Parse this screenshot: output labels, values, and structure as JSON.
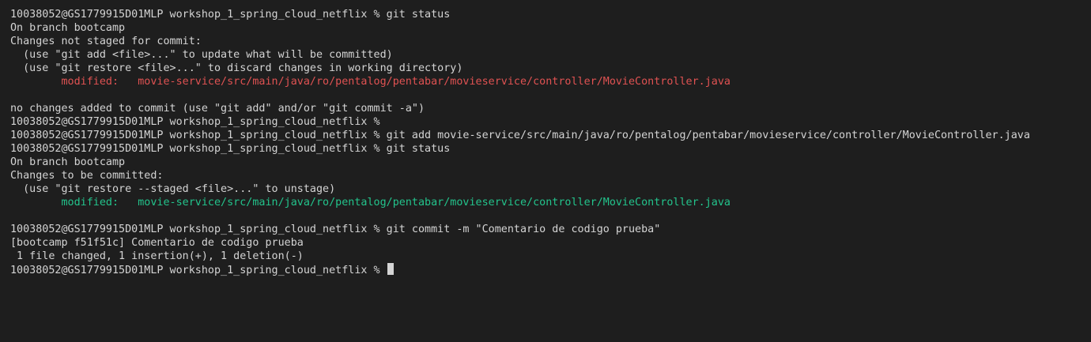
{
  "colors": {
    "background": "#1e1e1e",
    "text": "#d4d4d4",
    "unstaged": "#e05252",
    "staged": "#23c48c"
  },
  "terminal": {
    "lines": [
      {
        "kind": "prompt",
        "segments": [
          {
            "text": "10038052@GS1779915D01MLP workshop_1_spring_cloud_netflix % git status"
          }
        ]
      },
      {
        "kind": "output",
        "segments": [
          {
            "text": "On branch bootcamp"
          }
        ]
      },
      {
        "kind": "output",
        "segments": [
          {
            "text": "Changes not staged for commit:"
          }
        ]
      },
      {
        "kind": "output",
        "segments": [
          {
            "text": "  (use \"git add <file>...\" to update what will be committed)"
          }
        ]
      },
      {
        "kind": "output",
        "segments": [
          {
            "text": "  (use \"git restore <file>...\" to discard changes in working directory)"
          }
        ]
      },
      {
        "kind": "output",
        "segments": [
          {
            "text": "        modified:   movie-service/src/main/java/ro/pentalog/pentabar/movieservice/controller/MovieController.java",
            "color": "red"
          }
        ]
      },
      {
        "kind": "blank",
        "segments": [
          {
            "text": ""
          }
        ]
      },
      {
        "kind": "output",
        "segments": [
          {
            "text": "no changes added to commit (use \"git add\" and/or \"git commit -a\")"
          }
        ]
      },
      {
        "kind": "prompt",
        "segments": [
          {
            "text": "10038052@GS1779915D01MLP workshop_1_spring_cloud_netflix %"
          }
        ]
      },
      {
        "kind": "prompt",
        "segments": [
          {
            "text": "10038052@GS1779915D01MLP workshop_1_spring_cloud_netflix % git add movie-service/src/main/java/ro/pentalog/pentabar/movieservice/controller/MovieController.java"
          }
        ]
      },
      {
        "kind": "prompt",
        "segments": [
          {
            "text": "10038052@GS1779915D01MLP workshop_1_spring_cloud_netflix % git status"
          }
        ]
      },
      {
        "kind": "output",
        "segments": [
          {
            "text": "On branch bootcamp"
          }
        ]
      },
      {
        "kind": "output",
        "segments": [
          {
            "text": "Changes to be committed:"
          }
        ]
      },
      {
        "kind": "output",
        "segments": [
          {
            "text": "  (use \"git restore --staged <file>...\" to unstage)"
          }
        ]
      },
      {
        "kind": "output",
        "segments": [
          {
            "text": "        modified:   movie-service/src/main/java/ro/pentalog/pentabar/movieservice/controller/MovieController.java",
            "color": "green"
          }
        ]
      },
      {
        "kind": "blank",
        "segments": [
          {
            "text": ""
          }
        ]
      },
      {
        "kind": "prompt",
        "segments": [
          {
            "text": "10038052@GS1779915D01MLP workshop_1_spring_cloud_netflix % git commit -m \"Comentario de codigo prueba\""
          }
        ]
      },
      {
        "kind": "output",
        "segments": [
          {
            "text": "[bootcamp f51f51c] Comentario de codigo prueba"
          }
        ]
      },
      {
        "kind": "output",
        "segments": [
          {
            "text": " 1 file changed, 1 insertion(+), 1 deletion(-)"
          }
        ]
      },
      {
        "kind": "prompt",
        "segments": [
          {
            "text": "10038052@GS1779915D01MLP workshop_1_spring_cloud_netflix % "
          }
        ],
        "cursor": true
      }
    ]
  }
}
